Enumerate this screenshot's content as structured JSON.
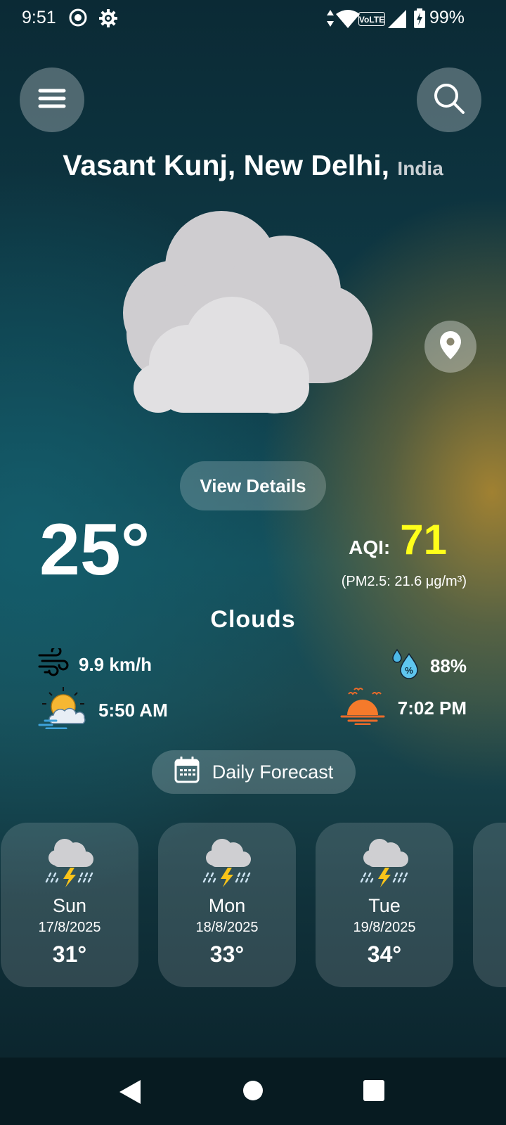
{
  "status_bar": {
    "time": "9:51",
    "battery": "99%",
    "icons": [
      "record-icon",
      "settings-icon",
      "data-arrows-icon",
      "wifi-icon",
      "volte-icon",
      "signal-icon",
      "battery-icon"
    ],
    "volte_label": "VoLTE"
  },
  "header": {
    "menu_icon": "hamburger-icon",
    "search_icon": "search-icon"
  },
  "location": {
    "city": "Vasant Kunj, New Delhi,",
    "country": "India"
  },
  "weather": {
    "icon": "cloud-icon",
    "view_details_label": "View Details",
    "temperature": "25°",
    "condition": "Clouds",
    "aqi_label": "AQI:",
    "aqi_value": "71",
    "pm_text": "(PM2.5: 21.6 μg/m³)",
    "aqi_color": "#ffff1a"
  },
  "metrics": {
    "wind": "9.9 km/h",
    "humidity": "88%",
    "sunrise": "5:50 AM",
    "sunset": "7:02 PM"
  },
  "daily_forecast": {
    "label": "Daily Forecast",
    "icon": "calendar-icon",
    "days": [
      {
        "day": "Sun",
        "date": "17/8/2025",
        "temp": "31°",
        "icon": "thunderstorm-icon"
      },
      {
        "day": "Mon",
        "date": "18/8/2025",
        "temp": "33°",
        "icon": "thunderstorm-icon"
      },
      {
        "day": "Tue",
        "date": "19/8/2025",
        "temp": "34°",
        "icon": "thunderstorm-icon"
      }
    ]
  },
  "nav": {
    "back_icon": "back-triangle-icon",
    "home_icon": "home-circle-icon",
    "recents_icon": "recents-square-icon"
  }
}
